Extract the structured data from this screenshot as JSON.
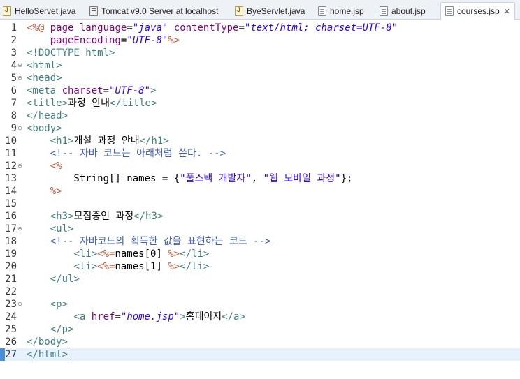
{
  "tabs": [
    {
      "label": "HelloServet.java",
      "icon": "java-file-icon"
    },
    {
      "label": "Tomcat v9.0 Server at localhost",
      "icon": "server-icon"
    },
    {
      "label": "ByeServlet.java",
      "icon": "java-file-icon"
    },
    {
      "label": "home.jsp",
      "icon": "jsp-file-icon"
    },
    {
      "label": "about.jsp",
      "icon": "jsp-file-icon"
    },
    {
      "label": "courses.jsp",
      "icon": "jsp-file-icon",
      "active": true,
      "close": "✕"
    }
  ],
  "editor": {
    "current_line": 27,
    "lines": [
      {
        "n": "1",
        "fold": "",
        "tokens": [
          [
            "dir",
            "<%@ "
          ],
          [
            "attr",
            "page "
          ],
          [
            "attr",
            "language"
          ],
          [
            "text",
            "="
          ],
          [
            "val",
            "\"java\""
          ],
          [
            "text",
            " "
          ],
          [
            "attr",
            "contentType"
          ],
          [
            "text",
            "="
          ],
          [
            "val",
            "\"text/html; charset=UTF-8\""
          ]
        ]
      },
      {
        "n": "2",
        "fold": "",
        "tokens": [
          [
            "text",
            "    "
          ],
          [
            "attr",
            "pageEncoding"
          ],
          [
            "text",
            "="
          ],
          [
            "val",
            "\"UTF-8\""
          ],
          [
            "dir",
            "%>"
          ]
        ]
      },
      {
        "n": "3",
        "fold": "",
        "tokens": [
          [
            "tag",
            "<!DOCTYPE html>"
          ]
        ]
      },
      {
        "n": "4",
        "fold": "⊖",
        "tokens": [
          [
            "tag",
            "<html>"
          ]
        ]
      },
      {
        "n": "5",
        "fold": "⊖",
        "tokens": [
          [
            "tag",
            "<head>"
          ]
        ]
      },
      {
        "n": "6",
        "fold": "",
        "tokens": [
          [
            "tag",
            "<meta "
          ],
          [
            "attr",
            "charset"
          ],
          [
            "text",
            "="
          ],
          [
            "val",
            "\"UTF-8\""
          ],
          [
            "tag",
            ">"
          ]
        ]
      },
      {
        "n": "7",
        "fold": "",
        "tokens": [
          [
            "tag",
            "<title>"
          ],
          [
            "text",
            "과정 안내"
          ],
          [
            "tag",
            "</title>"
          ]
        ]
      },
      {
        "n": "8",
        "fold": "",
        "tokens": [
          [
            "tag",
            "</head>"
          ]
        ]
      },
      {
        "n": "9",
        "fold": "⊖",
        "tokens": [
          [
            "tag",
            "<body>"
          ]
        ]
      },
      {
        "n": "10",
        "fold": "",
        "tokens": [
          [
            "text",
            "    "
          ],
          [
            "tag",
            "<h1>"
          ],
          [
            "text",
            "개설 과정 안내"
          ],
          [
            "tag",
            "</h1>"
          ]
        ]
      },
      {
        "n": "11",
        "fold": "",
        "tokens": [
          [
            "text",
            "    "
          ],
          [
            "cmt",
            "<!-- 자바 코드는 아래처럼 쓴다. -->"
          ]
        ]
      },
      {
        "n": "12",
        "fold": "⊖",
        "tokens": [
          [
            "text",
            "    "
          ],
          [
            "dir",
            "<%"
          ]
        ]
      },
      {
        "n": "13",
        "fold": "",
        "tokens": [
          [
            "text",
            "        String[] names = {"
          ],
          [
            "str",
            "\"풀스택 개발자\""
          ],
          [
            "text",
            ", "
          ],
          [
            "str",
            "\"웹 모바일 과정\""
          ],
          [
            "text",
            "};"
          ]
        ]
      },
      {
        "n": "14",
        "fold": "",
        "tokens": [
          [
            "text",
            "    "
          ],
          [
            "dir",
            "%>"
          ]
        ]
      },
      {
        "n": "15",
        "fold": "",
        "tokens": []
      },
      {
        "n": "16",
        "fold": "",
        "tokens": [
          [
            "text",
            "    "
          ],
          [
            "tag",
            "<h3>"
          ],
          [
            "text",
            "모집중인 과정"
          ],
          [
            "tag",
            "</h3>"
          ]
        ]
      },
      {
        "n": "17",
        "fold": "⊖",
        "tokens": [
          [
            "text",
            "    "
          ],
          [
            "tag",
            "<ul>"
          ]
        ]
      },
      {
        "n": "18",
        "fold": "",
        "tokens": [
          [
            "text",
            "    "
          ],
          [
            "cmt",
            "<!-- 자바코드의 획득한 값을 표현하는 코드 -->"
          ]
        ]
      },
      {
        "n": "19",
        "fold": "",
        "tokens": [
          [
            "text",
            "        "
          ],
          [
            "tag",
            "<li>"
          ],
          [
            "dir",
            "<%="
          ],
          [
            "text",
            "names[0] "
          ],
          [
            "dir",
            "%>"
          ],
          [
            "tag",
            "</li>"
          ]
        ]
      },
      {
        "n": "20",
        "fold": "",
        "tokens": [
          [
            "text",
            "        "
          ],
          [
            "tag",
            "<li>"
          ],
          [
            "dir",
            "<%="
          ],
          [
            "text",
            "names[1] "
          ],
          [
            "dir",
            "%>"
          ],
          [
            "tag",
            "</li>"
          ]
        ]
      },
      {
        "n": "21",
        "fold": "",
        "tokens": [
          [
            "text",
            "    "
          ],
          [
            "tag",
            "</ul>"
          ]
        ]
      },
      {
        "n": "22",
        "fold": "",
        "tokens": []
      },
      {
        "n": "23",
        "fold": "⊖",
        "tokens": [
          [
            "text",
            "    "
          ],
          [
            "tag",
            "<p>"
          ]
        ]
      },
      {
        "n": "24",
        "fold": "",
        "tokens": [
          [
            "text",
            "        "
          ],
          [
            "tag",
            "<a "
          ],
          [
            "attr",
            "href"
          ],
          [
            "text",
            "="
          ],
          [
            "val",
            "\"home.jsp\""
          ],
          [
            "tag",
            ">"
          ],
          [
            "text",
            "홈페이지"
          ],
          [
            "tag",
            "</a>"
          ]
        ]
      },
      {
        "n": "25",
        "fold": "",
        "tokens": [
          [
            "text",
            "    "
          ],
          [
            "tag",
            "</p>"
          ]
        ]
      },
      {
        "n": "26",
        "fold": "",
        "tokens": [
          [
            "tag",
            "</body>"
          ]
        ]
      },
      {
        "n": "27",
        "fold": "",
        "tokens": [
          [
            "tag",
            "</html>"
          ]
        ]
      }
    ]
  }
}
